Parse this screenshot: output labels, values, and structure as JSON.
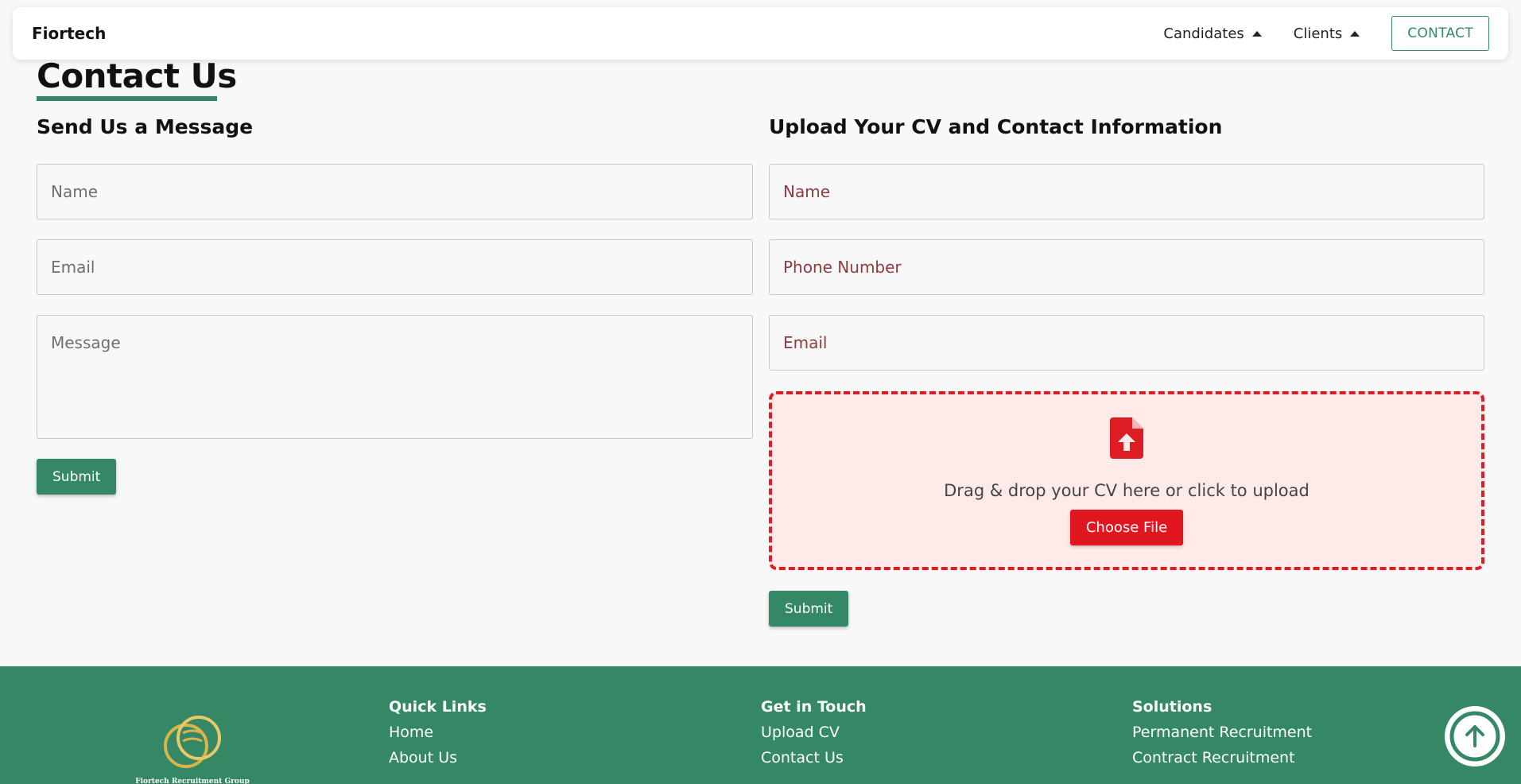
{
  "navbar": {
    "brand": "Fiortech",
    "items": [
      {
        "label": "Candidates"
      },
      {
        "label": "Clients"
      }
    ],
    "contact_label": "CONTACT"
  },
  "page": {
    "title": "Contact Us"
  },
  "message_form": {
    "title": "Send Us a Message",
    "name_placeholder": "Name",
    "email_placeholder": "Email",
    "message_placeholder": "Message",
    "submit_label": "Submit"
  },
  "cv_form": {
    "title": "Upload Your CV and Contact Information",
    "name_placeholder": "Name",
    "phone_placeholder": "Phone Number",
    "email_placeholder": "Email",
    "drop_text": "Drag & drop your CV here or click to upload",
    "choose_label": "Choose File",
    "submit_label": "Submit"
  },
  "footer": {
    "logo_caption": "Fiortech Recruitment Group",
    "quick_links": {
      "heading": "Quick Links",
      "links": [
        "Home",
        "About Us"
      ]
    },
    "get_in_touch": {
      "heading": "Get in Touch",
      "links": [
        "Upload CV",
        "Contact Us"
      ]
    },
    "solutions": {
      "heading": "Solutions",
      "links": [
        "Permanent Recruitment",
        "Contract Recruitment"
      ]
    }
  },
  "colors": {
    "brand_green": "#358865",
    "upload_red": "#dd1c23",
    "dropzone_bg": "#ffeaea",
    "logo_gold": "#d9b44a"
  },
  "icons": {
    "caret": "caret-up-icon",
    "upload": "file-upload-icon",
    "scroll_top": "arrow-up-icon"
  }
}
